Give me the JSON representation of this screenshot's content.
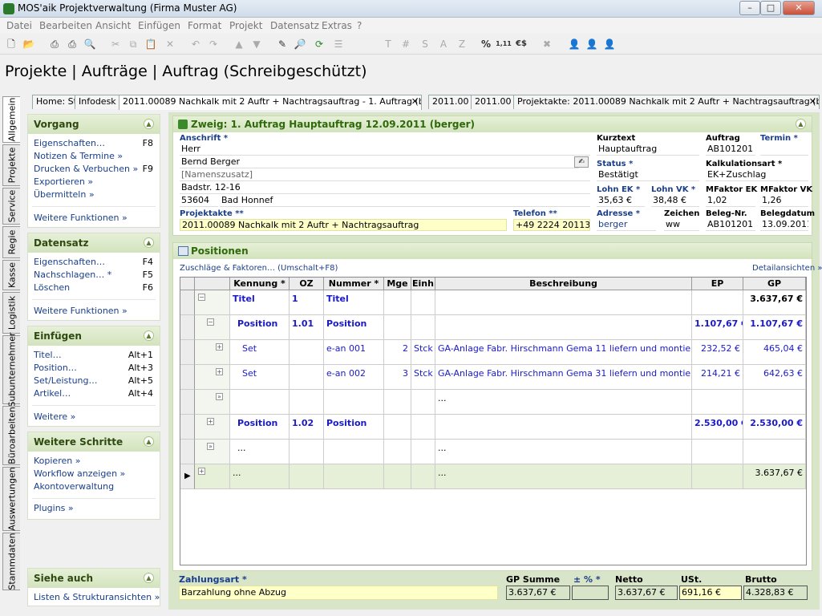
{
  "window": {
    "title": "MOS'aik Projektverwaltung (Firma Muster AG)",
    "min": "–",
    "max": "□",
    "close": "✕"
  },
  "menu": [
    "Datei",
    "Bearbeiten",
    "Ansicht",
    "Einfügen",
    "Format",
    "Projekt",
    "Datensatz",
    "Extras",
    "?"
  ],
  "toolbar": {
    "letters": [
      "T",
      "#",
      "S",
      "A",
      "Z"
    ],
    "percent": "%",
    "numbers": "1,11",
    "currency": "€$"
  },
  "heading": "Projekte | Aufträge | Auftrag (Schreibgeschützt)",
  "tabs": [
    {
      "label": "Home: St"
    },
    {
      "label": "Infodesk"
    },
    {
      "label": "2011.00089 Nachkalk mit 2 Auftr + Nachtragsauftrag - 1. Auftrag (berger)"
    },
    {
      "label": "2011.00"
    },
    {
      "label": "2011.00"
    },
    {
      "label": "Projektakte: 2011.00089 Nachkalk mit 2 Auftr + Nachtragsauftrag (berger)"
    }
  ],
  "vtabs": [
    "Allgemein",
    "Projekte",
    "Service",
    "Regie",
    "Kasse",
    "Logistik",
    "Subunternehmer",
    "Büroarbeiten",
    "Auswertungen",
    "Stammdaten"
  ],
  "sidebar": {
    "vorgang": {
      "title": "Vorgang",
      "items": [
        {
          "label": "Eigenschaften…",
          "key": "F8"
        },
        {
          "label": "Notizen & Termine »",
          "key": ""
        },
        {
          "label": "Drucken & Verbuchen »",
          "key": "F9"
        },
        {
          "label": "Exportieren »",
          "key": ""
        },
        {
          "label": "Übermitteln »",
          "key": ""
        }
      ],
      "more": "Weitere Funktionen »"
    },
    "datensatz": {
      "title": "Datensatz",
      "items": [
        {
          "label": "Eigenschaften…",
          "key": "F4"
        },
        {
          "label": "Nachschlagen… *",
          "key": "F5"
        },
        {
          "label": "Löschen",
          "key": "F6"
        }
      ],
      "more": "Weitere Funktionen »"
    },
    "einfuegen": {
      "title": "Einfügen",
      "items": [
        {
          "label": "Titel…",
          "key": "Alt+1"
        },
        {
          "label": "Position…",
          "key": "Alt+3"
        },
        {
          "label": "Set/Leistung…",
          "key": "Alt+5"
        },
        {
          "label": "Artikel…",
          "key": "Alt+4"
        }
      ],
      "more": "Weitere »"
    },
    "schritte": {
      "title": "Weitere Schritte",
      "items": [
        {
          "label": "Kopieren »"
        },
        {
          "label": "Workflow anzeigen »"
        },
        {
          "label": "Akontoverwaltung"
        }
      ],
      "more": "Plugins »"
    },
    "siehe": {
      "title": "Siehe auch",
      "items": [
        {
          "label": "Listen & Strukturansichten »"
        }
      ]
    }
  },
  "form": {
    "title": "Zweig: 1. Auftrag Hauptauftrag 12.09.2011 (berger)",
    "anschrift_label": "Anschrift *",
    "anrede": "Herr",
    "name": "Bernd Berger",
    "namenszusatz": "[Namenszusatz]",
    "strasse": "Badstr. 12-16",
    "plz": "53604",
    "ort": "Bad Honnef",
    "projektakte_label": "Projektakte **",
    "projektakte": "2011.00089 Nachkalk mit 2 Auftr + Nachtragsauftrag",
    "telefon_label": "Telefon **",
    "telefon": "+49 2224 2011345",
    "kurztext_label": "Kurztext",
    "kurztext": "Hauptauftrag",
    "auftrag_label": "Auftrag",
    "auftrag": "AB101201",
    "termin_label": "Termin *",
    "termin": "",
    "status_label": "Status *",
    "status": "Bestätigt",
    "kalk_label": "Kalkulationsart *",
    "kalk": "EK+Zuschlag",
    "lohnek_label": "Lohn EK *",
    "lohnek": "35,63 €",
    "lohnvk_label": "Lohn VK *",
    "lohnvk": "38,48 €",
    "mfek_label": "MFaktor EK",
    "mfek": "1,02",
    "mfvk_label": "MFaktor VK",
    "mfvk": "1,26",
    "adresse_label": "Adresse *",
    "adresse": "berger",
    "zeichen_label": "Zeichen",
    "zeichen": "ww",
    "belegnr_label": "Beleg-Nr.",
    "belegnr": "AB101201",
    "belegdatum_label": "Belegdatum",
    "belegdatum": "13.09.2011"
  },
  "positions": {
    "title": "Positionen",
    "zuschlaege": "Zuschläge & Faktoren… (Umschalt+F8)",
    "details": "Detailansichten »",
    "columns": [
      "Kennung *",
      "OZ",
      "Nummer *",
      "Mge",
      "Einh",
      "Beschreibung",
      "EP",
      "GP"
    ],
    "rows": [
      {
        "kennung": "Titel",
        "oz": "1",
        "nummer": "Titel",
        "mge": "",
        "einh": "",
        "beschreibung": "",
        "ep": "",
        "gp": "3.637,67 €",
        "level": 0,
        "type": "title"
      },
      {
        "kennung": "Position",
        "oz": "1.01",
        "nummer": "Position",
        "mge": "",
        "einh": "",
        "beschreibung": "",
        "ep": "1.107,67 €",
        "gp": "1.107,67 €",
        "level": 1,
        "type": "position"
      },
      {
        "kennung": "Set",
        "oz": "",
        "nummer": "e-an 001",
        "mge": "2",
        "einh": "Stck",
        "beschreibung": "GA-Anlage Fabr. Hirschmann Gema 11 liefern und montieren",
        "ep": "232,52 €",
        "gp": "465,04 €",
        "level": 2,
        "type": "set"
      },
      {
        "kennung": "Set",
        "oz": "",
        "nummer": "e-an 002",
        "mge": "3",
        "einh": "Stck",
        "beschreibung": "GA-Anlage Fabr. Hirschmann Gema 31 liefern und montieren",
        "ep": "214,21 €",
        "gp": "642,63 €",
        "level": 2,
        "type": "set"
      },
      {
        "kennung": "",
        "oz": "",
        "nummer": "",
        "mge": "",
        "einh": "",
        "beschreibung": "...",
        "ep": "",
        "gp": "",
        "level": 2,
        "type": "empty"
      },
      {
        "kennung": "Position",
        "oz": "1.02",
        "nummer": "Position",
        "mge": "",
        "einh": "",
        "beschreibung": "",
        "ep": "2.530,00 €",
        "gp": "2.530,00 €",
        "level": 1,
        "type": "position"
      },
      {
        "kennung": "...",
        "oz": "",
        "nummer": "",
        "mge": "",
        "einh": "",
        "beschreibung": "...",
        "ep": "",
        "gp": "",
        "level": 1,
        "type": "empty"
      },
      {
        "kennung": "...",
        "oz": "",
        "nummer": "",
        "mge": "",
        "einh": "",
        "beschreibung": "...",
        "ep": "",
        "gp": "3.637,67 €",
        "level": 0,
        "type": "current"
      }
    ]
  },
  "totals": {
    "zahlungsart_label": "Zahlungsart *",
    "zahlungsart": "Barzahlung ohne Abzug",
    "gpsumme_label": "GP Summe",
    "gpsumme": "3.637,67 €",
    "prozent_label": "± % *",
    "prozent": "",
    "netto_label": "Netto",
    "netto": "3.637,67 €",
    "ust_label": "USt.",
    "ust": "691,16 €",
    "brutto_label": "Brutto",
    "brutto": "4.328,83 €"
  }
}
